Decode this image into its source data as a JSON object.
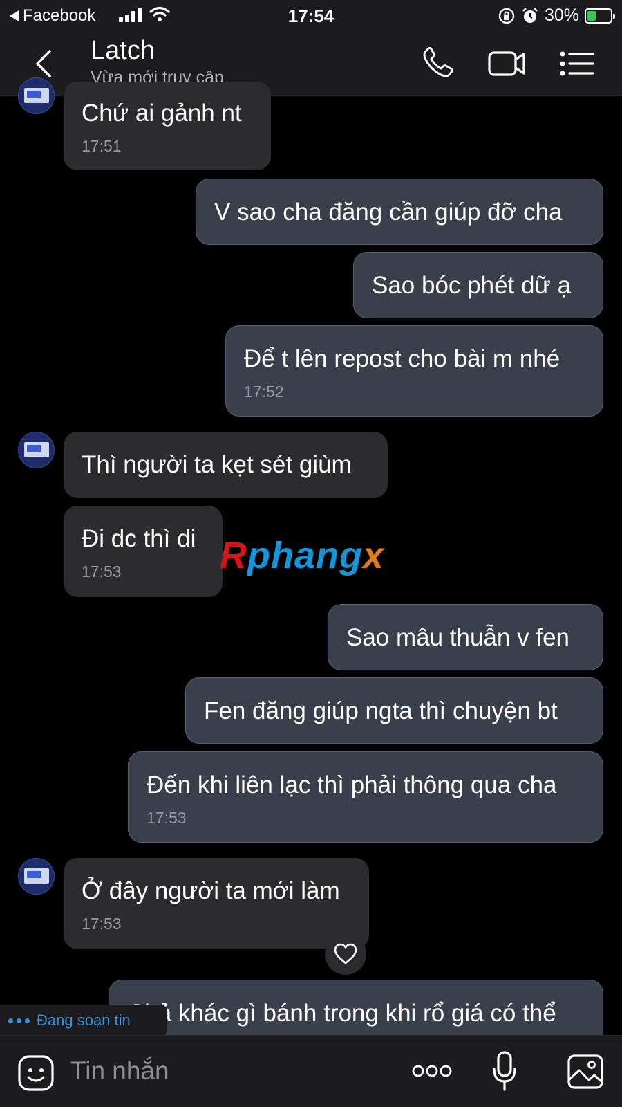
{
  "status_bar": {
    "back_app": "Facebook",
    "time": "17:54",
    "battery": "30%"
  },
  "header": {
    "contact_name": "Latch",
    "contact_status": "Vừa mới truy cập"
  },
  "messages": [
    {
      "dir": "in",
      "text": "Chứ ai gảnh nt",
      "time": "17:51"
    },
    {
      "dir": "out",
      "text": "V sao cha đăng cần giúp đỡ cha"
    },
    {
      "dir": "out",
      "text": "Sao bóc phét dữ ạ"
    },
    {
      "dir": "out",
      "text": "Để t lên repost cho bài m nhé",
      "time": "17:52"
    },
    {
      "dir": "in",
      "text": "Thì người ta kẹt sét giùm"
    },
    {
      "dir": "in",
      "text": "Đi dc thì di",
      "time": "17:53"
    },
    {
      "dir": "out",
      "text": "Sao mâu thuẫn v fen"
    },
    {
      "dir": "out",
      "text": "Fen đăng giúp ngta thì chuyện bt"
    },
    {
      "dir": "out",
      "text": "Đến khi liên lạc thì phải thông qua cha",
      "time": "17:53"
    },
    {
      "dir": "in",
      "text": "Ở đây người ta mới làm",
      "time": "17:53"
    },
    {
      "dir": "out",
      "text": "Chả khác gì bánh trong khi rổ giá có thể"
    }
  ],
  "watermark": {
    "part1": "R",
    "part2": "phang",
    "part3": "x"
  },
  "typing_indicator": "Đang soạn tin",
  "composer": {
    "placeholder": "Tin nhắn"
  }
}
